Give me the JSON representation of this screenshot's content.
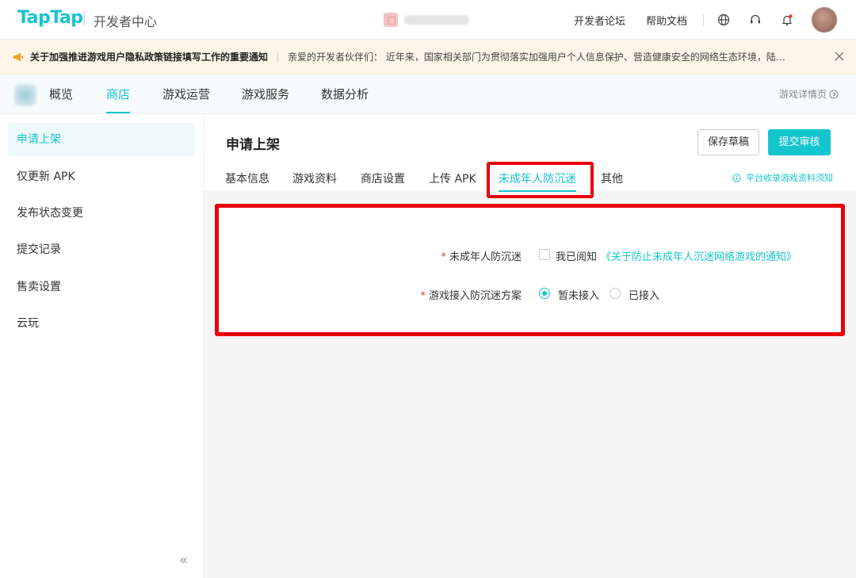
{
  "header": {
    "logo": "TapTap",
    "subtitle": "开发者中心",
    "links": [
      "开发者论坛",
      "帮助文档"
    ],
    "icons": [
      "globe-icon",
      "headset-icon",
      "bell-icon"
    ]
  },
  "notice": {
    "title": "关于加强推进游戏用户隐私政策链接填写工作的重要通知",
    "body": "亲爱的开发者伙伴们：  近年来，国家相关部门为贯彻落实加强用户个人信息保护、营造健康安全的网络生态环境，陆…"
  },
  "mainnav": {
    "items": [
      "概览",
      "商店",
      "游戏运营",
      "游戏服务",
      "数据分析"
    ],
    "active": "商店",
    "detail_link": "游戏详情页"
  },
  "sidebar": {
    "items": [
      "申请上架",
      "仅更新 APK",
      "发布状态变更",
      "提交记录",
      "售卖设置",
      "云玩"
    ],
    "active": "申请上架",
    "collapse": "«"
  },
  "page": {
    "title": "申请上架",
    "save_label": "保存草稿",
    "submit_label": "提交审核",
    "tabs": [
      "基本信息",
      "游戏资料",
      "商店设置",
      "上传 APK",
      "未成年人防沉迷",
      "其他"
    ],
    "active_tab": "未成年人防沉迷",
    "tip": "平台收录游戏资料须知"
  },
  "form": {
    "row1": {
      "required": "*",
      "label": "未成年人防沉迷",
      "checkbox_label": "我已阅知",
      "link": "《关于防止未成年人沉迷网络游戏的通知》",
      "checked": false
    },
    "row2": {
      "required": "*",
      "label": "游戏接入防沉迷方案",
      "options": [
        "暂未接入",
        "已接入"
      ],
      "selected": "暂未接入"
    }
  },
  "colors": {
    "accent": "#15c5ce",
    "highlight": "#e8000b",
    "required": "#e8352b"
  }
}
